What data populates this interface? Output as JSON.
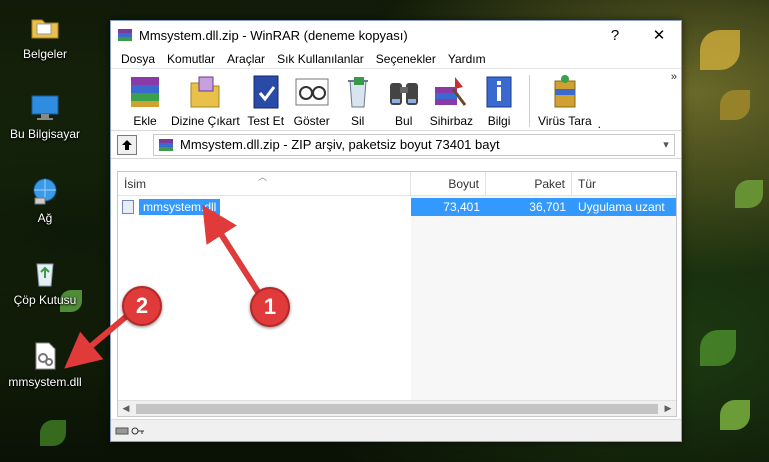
{
  "desktop": {
    "icons": [
      {
        "label": "Belgeler",
        "icon": "folder-icon"
      },
      {
        "label": "Bu Bilgisayar",
        "icon": "computer-icon"
      },
      {
        "label": "Ağ",
        "icon": "network-icon"
      },
      {
        "label": "Çöp Kutusu",
        "icon": "recycle-bin-icon"
      },
      {
        "label": "mmsystem.dll",
        "icon": "dll-file-icon"
      }
    ]
  },
  "window": {
    "title": "Mmsystem.dll.zip - WinRAR (deneme kopyası)",
    "help_btn": "?",
    "close_btn": "✕",
    "menu": [
      "Dosya",
      "Komutlar",
      "Araçlar",
      "Sık Kullanılanlar",
      "Seçenekler",
      "Yardım"
    ],
    "toolbar": [
      {
        "label": "Ekle",
        "icon": "add-archive-icon"
      },
      {
        "label": "Dizine Çıkart",
        "icon": "extract-to-icon"
      },
      {
        "label": "Test Et",
        "icon": "test-icon"
      },
      {
        "label": "Göster",
        "icon": "view-icon"
      },
      {
        "label": "Sil",
        "icon": "delete-icon"
      },
      {
        "label": "Bul",
        "icon": "find-icon"
      },
      {
        "label": "Sihirbaz",
        "icon": "wizard-icon"
      },
      {
        "label": "Bilgi",
        "icon": "info-icon"
      },
      {
        "label": "Virüs Tara",
        "icon": "virus-scan-icon"
      }
    ],
    "toolbar_more": "»",
    "toolbar_overflow_char": ".",
    "address": "Mmsystem.dll.zip - ZIP arşiv, paketsiz boyut 73401 bayt",
    "columns": {
      "name": "İsim",
      "size": "Boyut",
      "packed": "Paket",
      "type": "Tür"
    },
    "files": [
      {
        "name": "mmsystem.dll",
        "size": "73,401",
        "packed": "36,701",
        "type": "Uygulama uzant"
      }
    ]
  },
  "annotations": {
    "badge1": "1",
    "badge2": "2",
    "color": "#e03a3a"
  }
}
